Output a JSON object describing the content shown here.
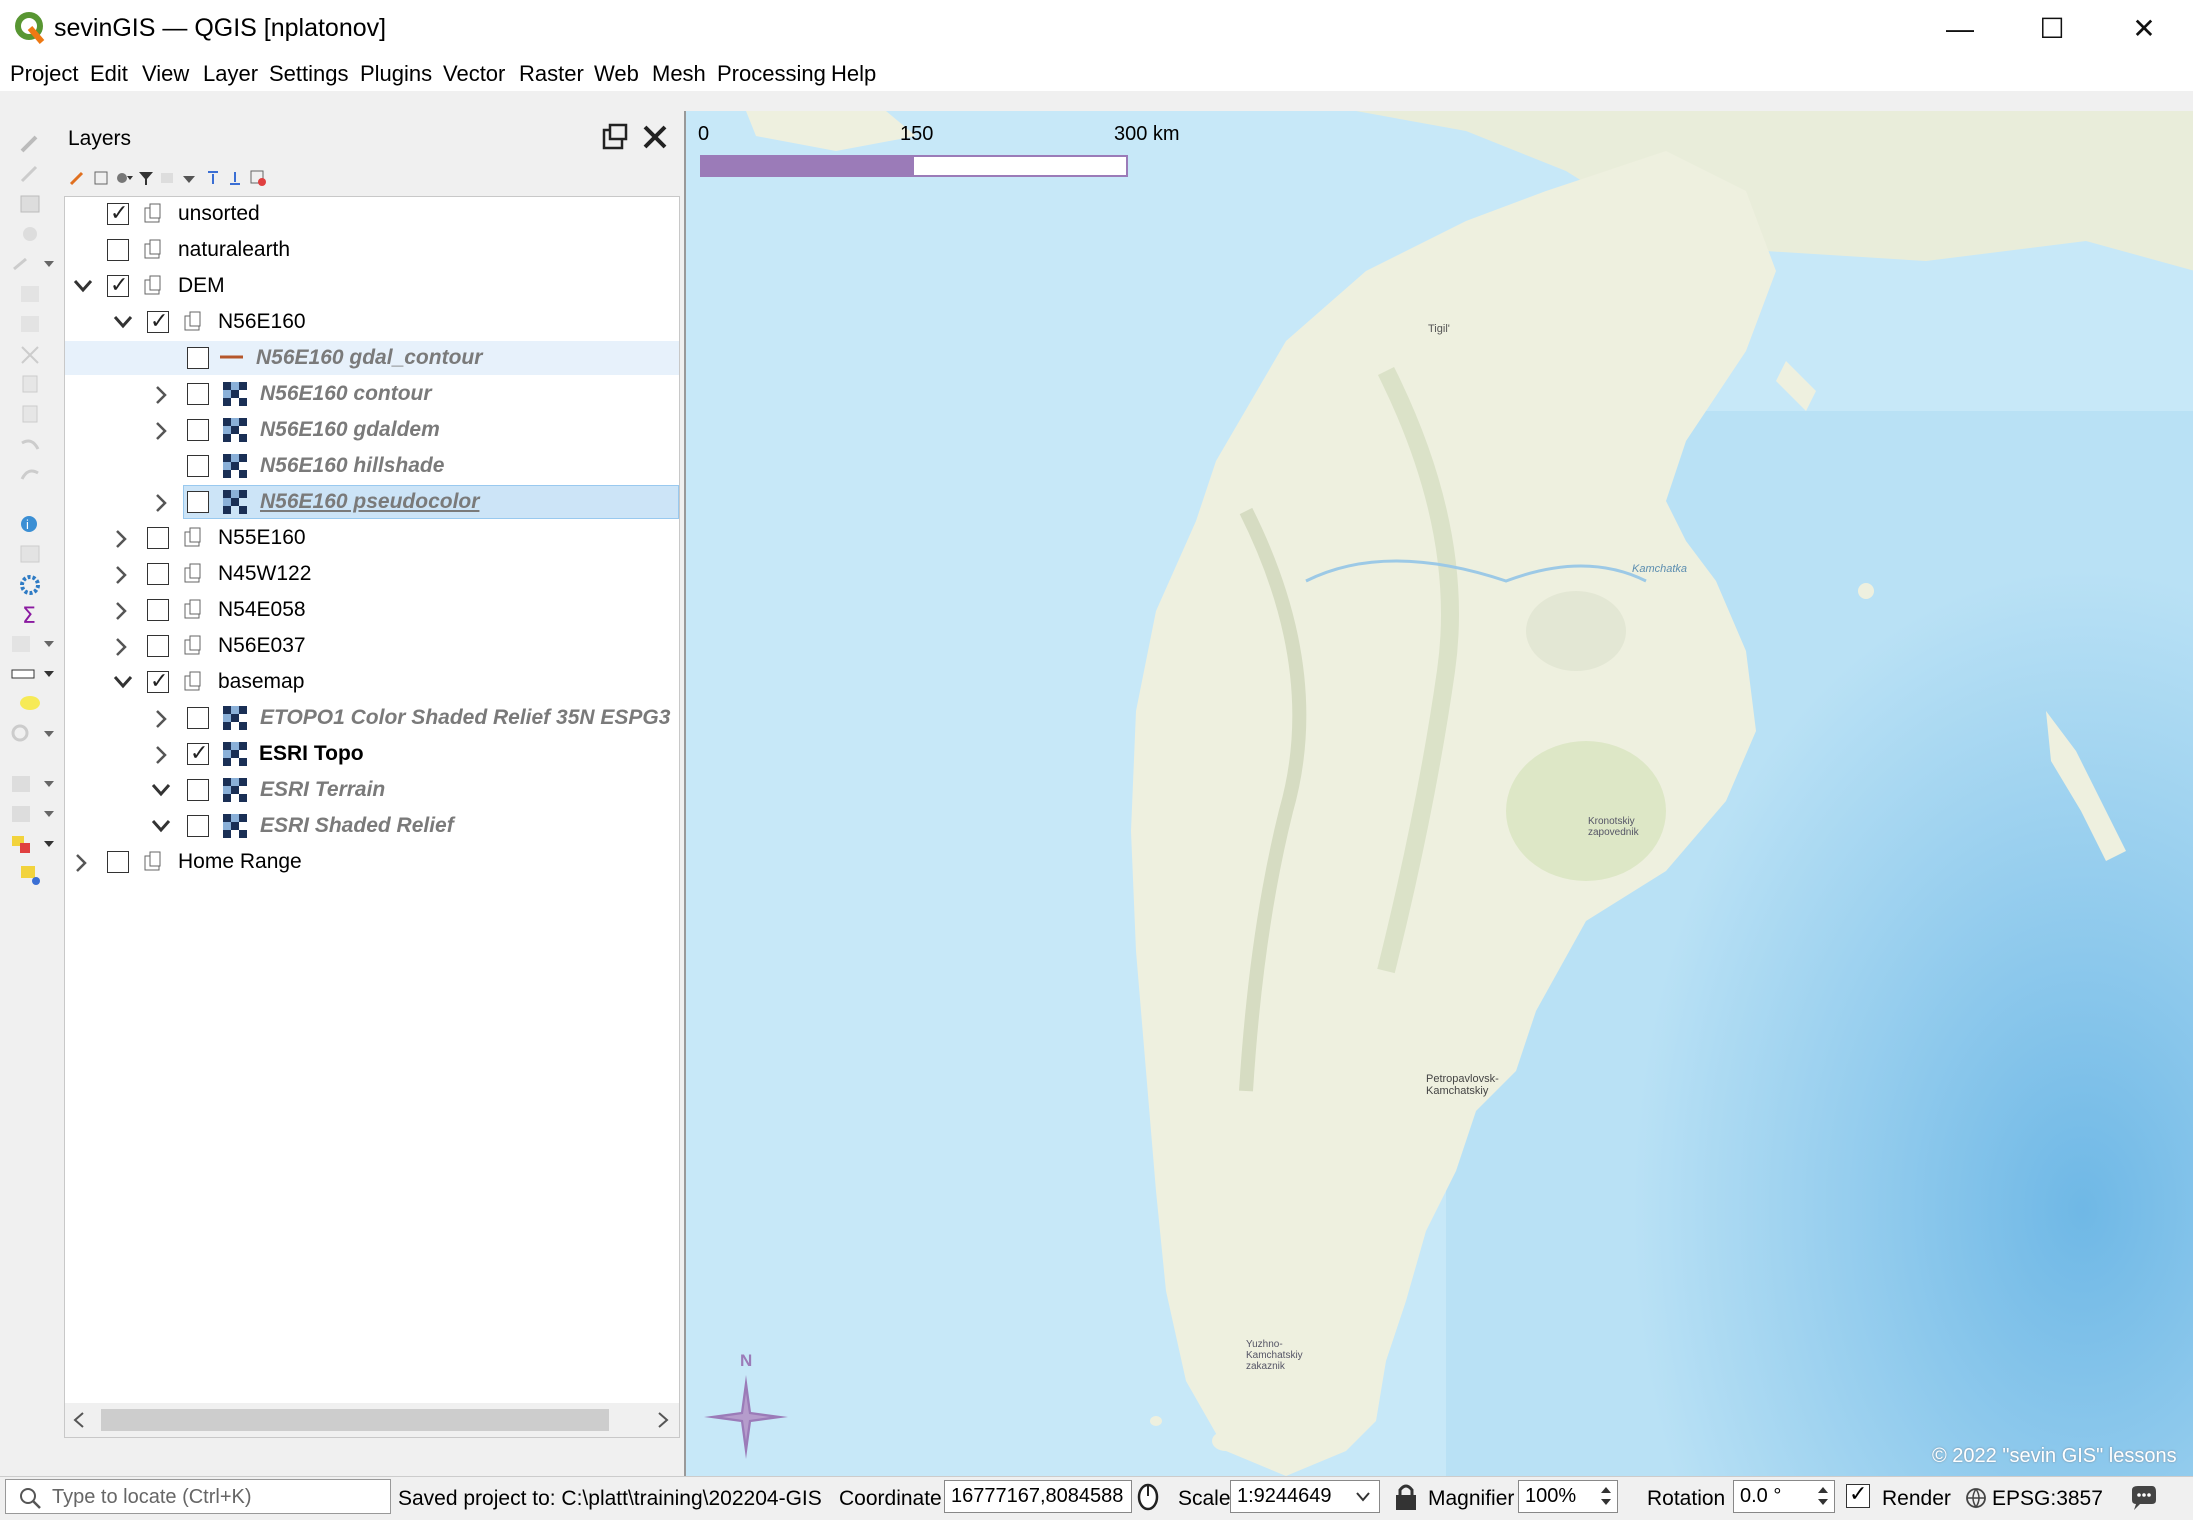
{
  "window": {
    "title": "sevinGIS — QGIS [nplatonov]",
    "minimize": "—",
    "maximize": "☐",
    "close": "✕"
  },
  "menu": [
    "Project",
    "Edit",
    "View",
    "Layer",
    "Settings",
    "Plugins",
    "Vector",
    "Raster",
    "Web",
    "Mesh",
    "Processing",
    "Help"
  ],
  "layers_panel": {
    "title": "Layers",
    "tree": [
      {
        "label": "unsorted",
        "checked": true,
        "expander": "none",
        "style": "normal"
      },
      {
        "label": "naturalearth",
        "checked": false,
        "expander": "collapsed",
        "style": "normal"
      },
      {
        "label": "DEM",
        "checked": true,
        "expander": "expanded",
        "style": "normal"
      },
      {
        "label": "N56E160",
        "checked": true,
        "expander": "expanded",
        "style": "normal"
      },
      {
        "label": "N56E160 gdal_contour",
        "checked": false,
        "expander": "none",
        "style": "italic"
      },
      {
        "label": "N56E160 contour",
        "checked": false,
        "expander": "collapsed",
        "style": "italic"
      },
      {
        "label": "N56E160 gdaldem",
        "checked": false,
        "expander": "collapsed",
        "style": "italic"
      },
      {
        "label": "N56E160 hillshade",
        "checked": false,
        "expander": "none",
        "style": "italic"
      },
      {
        "label": "N56E160 pseudocolor",
        "checked": false,
        "expander": "collapsed",
        "style": "italic"
      },
      {
        "label": "N55E160",
        "checked": false,
        "expander": "collapsed",
        "style": "normal"
      },
      {
        "label": "N45W122",
        "checked": false,
        "expander": "collapsed",
        "style": "normal"
      },
      {
        "label": "N54E058",
        "checked": false,
        "expander": "collapsed",
        "style": "normal"
      },
      {
        "label": "N56E037",
        "checked": false,
        "expander": "collapsed",
        "style": "normal"
      },
      {
        "label": "basemap",
        "checked": true,
        "expander": "expanded",
        "style": "normal"
      },
      {
        "label": "ETOPO1 Color Shaded Relief 35N ESPG3",
        "checked": false,
        "expander": "collapsed",
        "style": "italic"
      },
      {
        "label": "ESRI Topo",
        "checked": true,
        "expander": "collapsed",
        "style": "bold"
      },
      {
        "label": "ESRI Terrain",
        "checked": false,
        "expander": "expanded",
        "style": "italic"
      },
      {
        "label": "ESRI Shaded Relief",
        "checked": false,
        "expander": "expanded",
        "style": "italic"
      },
      {
        "label": "Home Range",
        "checked": false,
        "expander": "collapsed",
        "style": "normal"
      }
    ]
  },
  "map": {
    "scale_labels": [
      "0",
      "150",
      "300 km"
    ],
    "place_labels": {
      "tigil": "Tigil'",
      "kamchatka": "Kamchatka",
      "kronotsky": "Kronotskiy zapovednik",
      "petropavlovsk": "Petropavlovsk-Kamchatskiy",
      "yuzhno": "Yuzhno-Kamchatskiy zakaznik"
    },
    "north_label": "N",
    "copyright": "© 2022 \"sevin GIS\" lessons",
    "colors": {
      "water": "#b9e1f5",
      "land": "#eef0df",
      "scalebar": "#9b7bb8"
    }
  },
  "statusbar": {
    "locate_placeholder": "Type to locate (Ctrl+K)",
    "message": "Saved project to: C:\\platt\\training\\202204-GIS",
    "coordinate_label": "Coordinate",
    "coordinate_value": "16777167,8084588",
    "scale_label": "Scale",
    "scale_value": "1:9244649",
    "magnifier_label": "Magnifier",
    "magnifier_value": "100%",
    "rotation_label": "Rotation",
    "rotation_value": "0.0 °",
    "render_label": "Render",
    "render_checked": true,
    "crs": "EPSG:3857"
  }
}
